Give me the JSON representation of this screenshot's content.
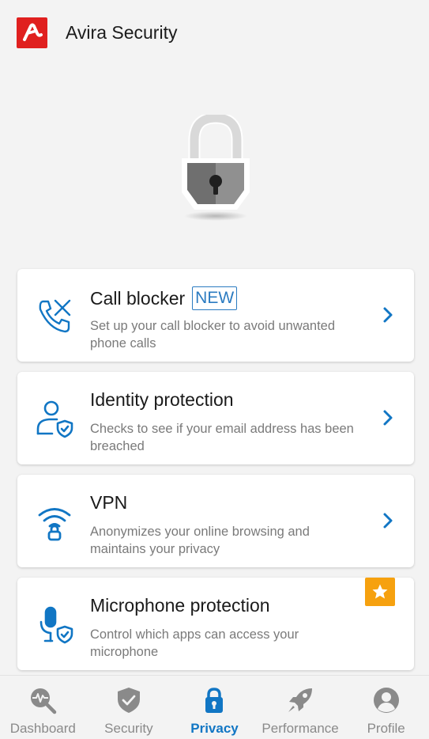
{
  "app": {
    "title": "Avira Security"
  },
  "cards": [
    {
      "title": "Call blocker",
      "badge": "NEW",
      "description": "Set up your call blocker to avoid unwanted phone calls",
      "icon": "phone-cross-icon"
    },
    {
      "title": "Identity protection",
      "description": "Checks to see if your email address has been breached",
      "icon": "user-shield-icon"
    },
    {
      "title": "VPN",
      "description": "Anonymizes your online browsing and maintains your privacy",
      "icon": "wifi-lock-icon"
    },
    {
      "title": "Microphone protection",
      "description": "Control which apps can access your microphone",
      "icon": "microphone-shield-icon",
      "premium": true
    }
  ],
  "nav": {
    "items": [
      {
        "label": "Dashboard",
        "icon": "dashboard-icon",
        "active": false
      },
      {
        "label": "Security",
        "icon": "shield-check-icon",
        "active": false
      },
      {
        "label": "Privacy",
        "icon": "lock-icon",
        "active": true
      },
      {
        "label": "Performance",
        "icon": "rocket-icon",
        "active": false
      },
      {
        "label": "Profile",
        "icon": "profile-icon",
        "active": false
      }
    ]
  },
  "colors": {
    "accent": "#1176c4",
    "brand": "#e0201f",
    "premium": "#f6a10f",
    "background": "#f3f3f3"
  }
}
